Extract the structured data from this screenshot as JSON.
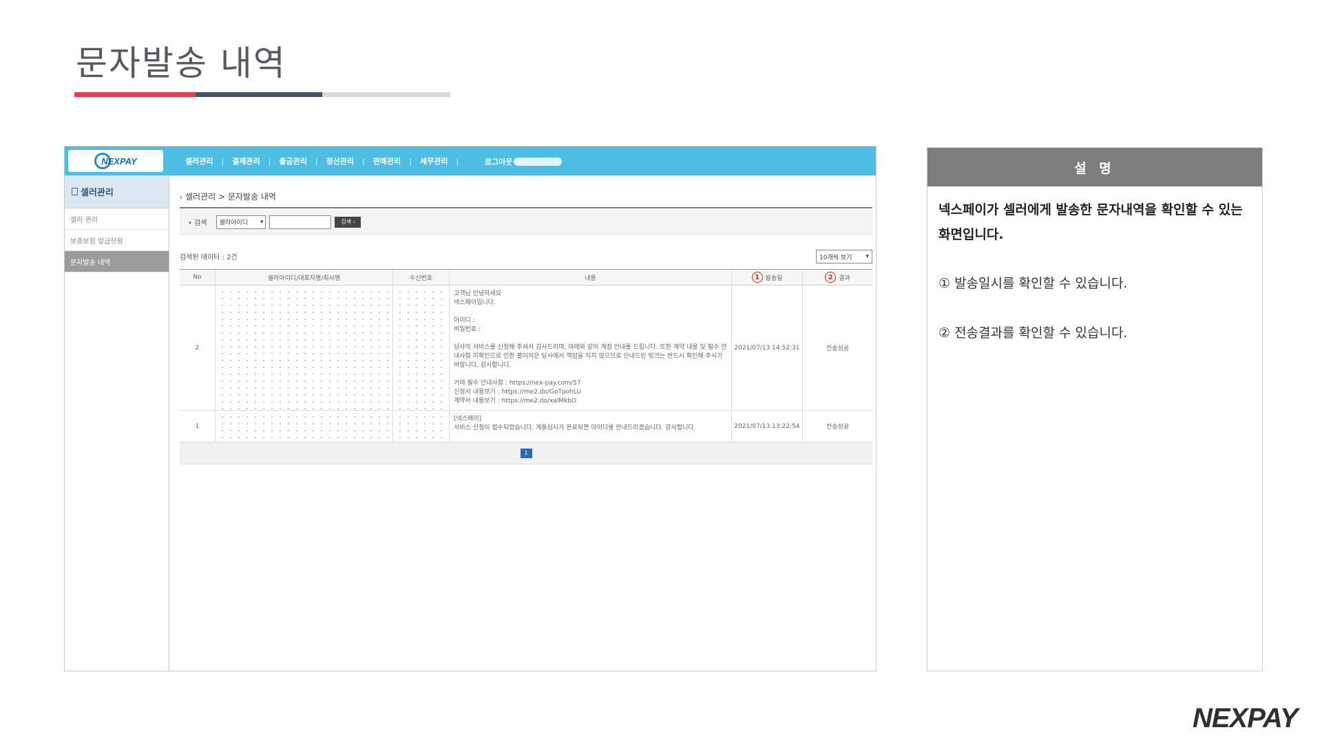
{
  "slide": {
    "title": "문자발송 내역",
    "brand": "NEXPAY"
  },
  "screenshot": {
    "logo": "NEXPAY",
    "nav": [
      "셀러관리",
      "결제관리",
      "출금관리",
      "정산관리",
      "판매관리",
      "세무관리"
    ],
    "nav_sep": "|",
    "logout_label": "로그아웃",
    "sidebar": {
      "title": "셀러관리",
      "items": [
        {
          "label": "셀러 관리",
          "active": false
        },
        {
          "label": "보증보험 발급현황",
          "active": false
        },
        {
          "label": "문자발송 내역",
          "active": true
        }
      ]
    },
    "breadcrumb": "셀러관리 > 문자발송 내역",
    "search": {
      "label": "• 검색",
      "select_value": "셀러아이디",
      "input_value": "",
      "button_label": "검색 ›"
    },
    "result_count": "검색된 데이터 : 2건",
    "per_page": "10개씩 보기",
    "columns": {
      "no": "No",
      "seller": "셀러아이디/대표자명/회사명",
      "phone": "수신번호",
      "body": "내용",
      "date": "발송일",
      "result": "결과"
    },
    "markers": {
      "date": "1",
      "result": "2"
    },
    "rows": [
      {
        "no": "2",
        "body": "고객님 안녕하세요\n넥스페이입니다.\n\n아이디 :\n비밀번호 :\n\n당사의 서비스를 신청해 주셔서 감사드리며, 아래와 같이 계정 안내를 드립니다. 또한 계약 내용 및 필수 안내사항 미확인으로 인한 불이익은 당사에서 책임을 지지 않으므로 안내드린 링크는 반드시 확인해 주시기 바랍니다. 감사합니다.\n\n거래 필수 안내사항 : https://nex-pay.com/57\n신청서 내용보기 : https://me2.do/GoTpohLU\n계약서 내용보기 : https://me2.do/xalMkbO",
        "date": "2021/07/13 14:52:31",
        "result": "전송성공"
      },
      {
        "no": "1",
        "body": "[넥스페이]\n서비스 신청이 접수되었습니다. 계통심사가 완료되면 아이디를 안내드리겠습니다. 감사합니다.",
        "date": "2021/07/13 13:22:54",
        "result": "전송성공"
      }
    ],
    "page": "1"
  },
  "description": {
    "header": "설 명",
    "lead": "넥스페이가 셀러에게 발송한 문자내역을 확인할 수 있는 화면입니다.",
    "item1": "① 발송일시를 확인할 수 있습니다.",
    "item2": "② 전송결과를 확인할 수 있습니다."
  }
}
